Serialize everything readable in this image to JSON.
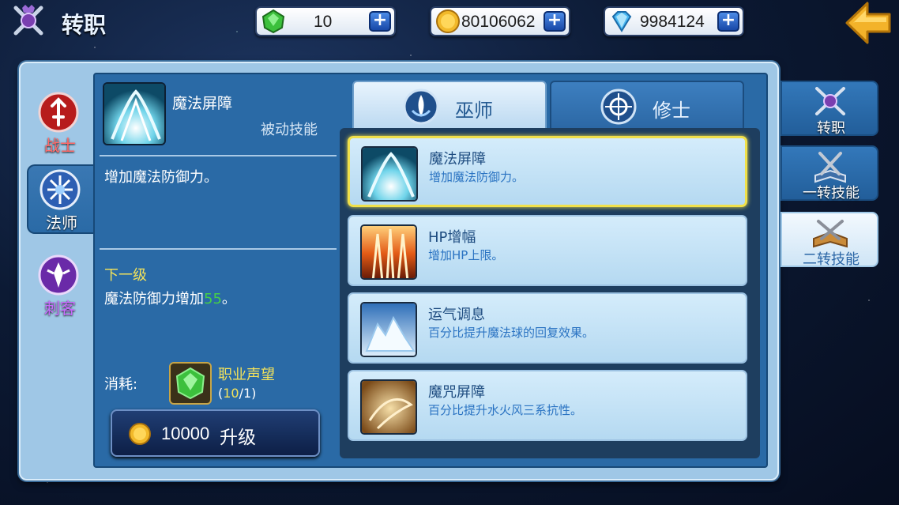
{
  "header": {
    "title": "转职",
    "gems": "10",
    "gold": "80106062",
    "diamonds": "9984124",
    "plus_label": "+"
  },
  "classes": [
    {
      "name": "战士",
      "color": "#ff6a6a"
    },
    {
      "name": "法师",
      "color": "#ffffff"
    },
    {
      "name": "刺客",
      "color": "#c96cff"
    }
  ],
  "selected_skill": {
    "name": "魔法屏障",
    "type": "被动技能",
    "description": "增加魔法防御力。",
    "next_level_title": "下一级",
    "next_level_desc_prefix": "魔法防御力增加",
    "next_level_value": "55",
    "next_level_desc_suffix": "。"
  },
  "cost": {
    "label": "消耗:",
    "item_name": "职业声望",
    "paren_open": "(",
    "have": "10",
    "need": "/1)"
  },
  "upgrade": {
    "cost": "10000",
    "label": "升级"
  },
  "branches": [
    {
      "name": "巫师",
      "active": true
    },
    {
      "name": "修士",
      "active": false
    }
  ],
  "skills": [
    {
      "name": "魔法屏障",
      "desc": "增加魔法防御力。"
    },
    {
      "name": "HP增幅",
      "desc": "增加HP上限。"
    },
    {
      "name": "运气调息",
      "desc": "百分比提升魔法球的回复效果。"
    },
    {
      "name": "魔咒屏障",
      "desc": "百分比提升水火风三系抗性。"
    }
  ],
  "right_tabs": [
    {
      "label": "转职"
    },
    {
      "label": "一转技能"
    },
    {
      "label": "二转技能"
    }
  ],
  "colors": {
    "accent_yellow": "#f4e35a",
    "accent_green": "#46d046",
    "panel_blue": "#2a6aa6"
  }
}
